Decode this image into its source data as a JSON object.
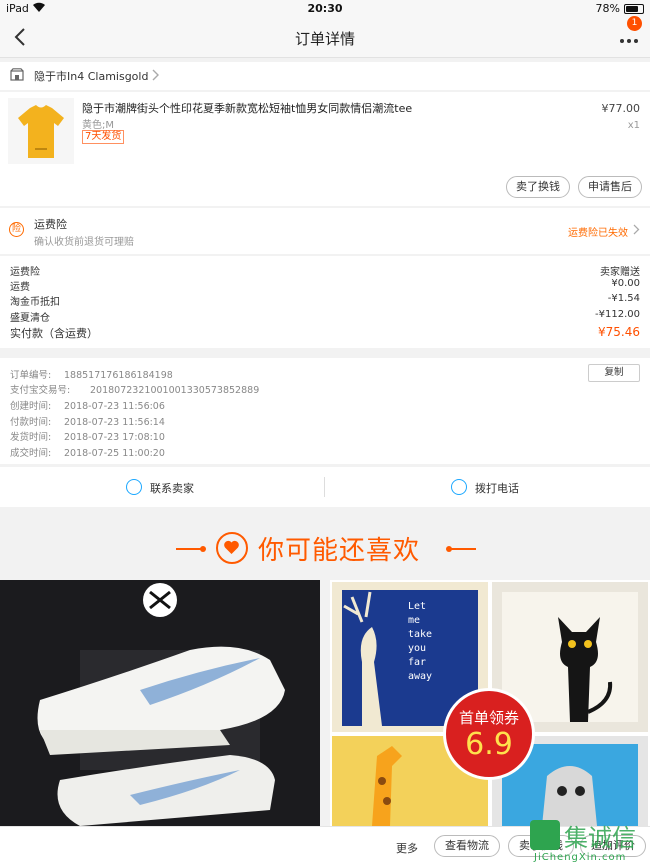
{
  "status_bar": {
    "carrier": "iPad",
    "time": "20:30",
    "battery": "78%",
    "battery_level": 0.78
  },
  "nav": {
    "title": "订单详情",
    "badge": "1"
  },
  "shop": {
    "name": "隐于市In4  Clamisgold"
  },
  "item": {
    "title": "隐于市潮牌街头个性印花夏季新款宽松短袖t恤男女同款情侣潮流tee",
    "sku": "黄色;M",
    "tag": "7天发货",
    "price": "¥77.00",
    "qty": "x1",
    "shirt_color": "#f3b21e",
    "buttons": {
      "exchange": "卖了换钱",
      "after_sale": "申请售后"
    }
  },
  "insurance": {
    "icon": "险",
    "title": "运费险",
    "subtitle": "确认收货前退货可理赔",
    "status": "运费险已失效"
  },
  "costs": [
    {
      "label": "运费险",
      "value": "卖家赠送"
    },
    {
      "label": "运费",
      "value": "¥0.00"
    },
    {
      "label": "淘金币抵扣",
      "value": "-¥1.54"
    },
    {
      "label": "盛夏清仓",
      "value": "-¥112.00"
    }
  ],
  "total": {
    "label": "实付款（含运费）",
    "value": "¥75.46"
  },
  "order_info": {
    "copy_label": "复制",
    "rows": [
      {
        "label": "订单编号:",
        "value": "188517176186184198"
      },
      {
        "label": "支付宝交易号:",
        "value": "2018072321001001330573852889"
      },
      {
        "label": "创建时间:",
        "value": "2018-07-23 11:56:06"
      },
      {
        "label": "付款时间:",
        "value": "2018-07-23 11:56:14"
      },
      {
        "label": "发货时间:",
        "value": "2018-07-23 17:08:10"
      },
      {
        "label": "成交时间:",
        "value": "2018-07-25 11:00:20"
      }
    ]
  },
  "contact": {
    "seller": "联系卖家",
    "phone": "拨打电话"
  },
  "recommend": {
    "title": "你可能还喜欢"
  },
  "products": {
    "pillow_text": "Let\nme\ntake\nyou\nfar\naway",
    "coupon_line1": "首单领券",
    "coupon_line2": "6.9"
  },
  "bottom_bar": {
    "more": "更多",
    "logistics": "查看物流",
    "sell": "卖了换钱",
    "review": "追加评价"
  },
  "watermark": {
    "text": "集诚信",
    "url": "JiChengXin.com"
  },
  "colors": {
    "accent": "#ff5000",
    "link_blue": "#1da8ff",
    "coupon_red": "#d9201f"
  }
}
